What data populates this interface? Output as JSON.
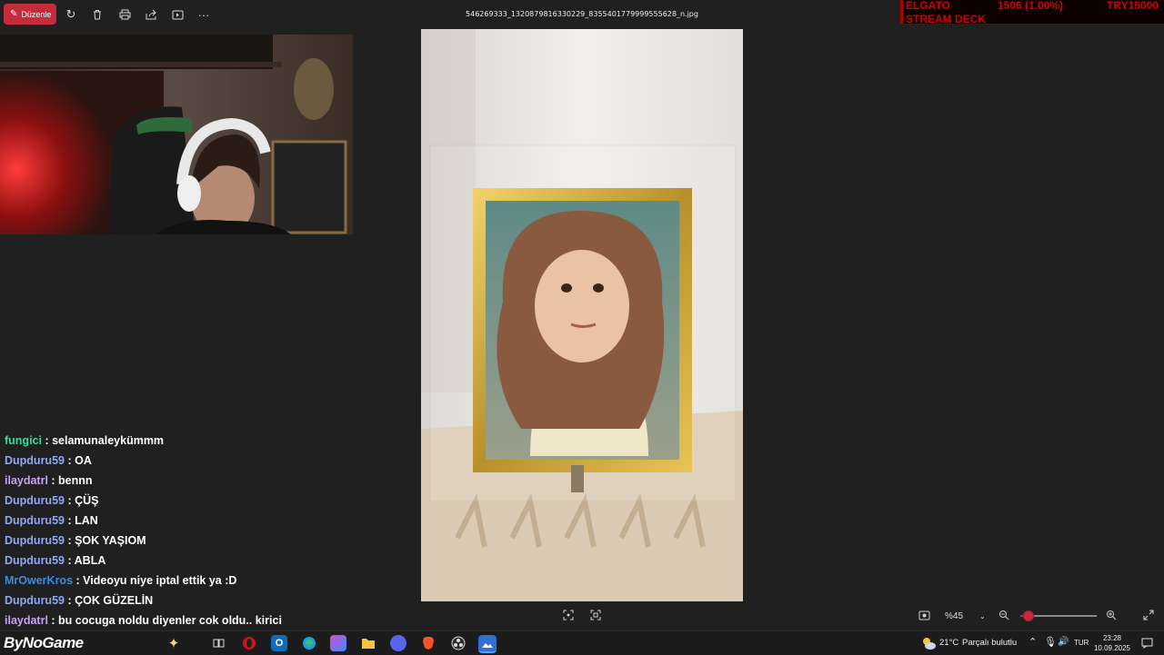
{
  "toolbar": {
    "edit_label": "Düzenle",
    "file_name": "546269333_1320879816330229_8355401779999555628_n.jpg"
  },
  "ticker": {
    "line1": [
      "ELGATO",
      "1506 (1.00%)",
      "TRY15000"
    ],
    "line2": "STREAM DECK"
  },
  "chat": [
    {
      "user": "fungici",
      "color": "#3ad89a",
      "message": "selamunaleykümmm"
    },
    {
      "user": "Dupduru59",
      "color": "#8fa8f0",
      "message": "OA"
    },
    {
      "user": "ilaydatrl",
      "color": "#c7a2f0",
      "message": "bennn"
    },
    {
      "user": "Dupduru59",
      "color": "#8fa8f0",
      "message": "ÇÜŞ"
    },
    {
      "user": "Dupduru59",
      "color": "#8fa8f0",
      "message": "LAN"
    },
    {
      "user": "Dupduru59",
      "color": "#8fa8f0",
      "message": "ŞOK YAŞIOM"
    },
    {
      "user": "Dupduru59",
      "color": "#8fa8f0",
      "message": "ABLA"
    },
    {
      "user": "MrOwerKros",
      "color": "#3d8be0",
      "message": "Videoyu niye iptal ettik ya :D"
    },
    {
      "user": "Dupduru59",
      "color": "#8fa8f0",
      "message": "ÇOK GÜZELİN"
    },
    {
      "user": "ilaydatrl",
      "color": "#c7a2f0",
      "message": "bu cocuga noldu diyenler cok oldu.. kirici"
    }
  ],
  "viewer": {
    "zoom_label": "%45",
    "zoom_level": 0.1
  },
  "taskbar": {
    "brand": "ByNoGame",
    "weather_temp": "21°C",
    "weather_text": "Parçalı bulutlu",
    "language": "TUR",
    "time": "23:28",
    "date": "10.09.2025"
  },
  "colors": {
    "accent": "#c42b3c",
    "background": "#202020"
  }
}
